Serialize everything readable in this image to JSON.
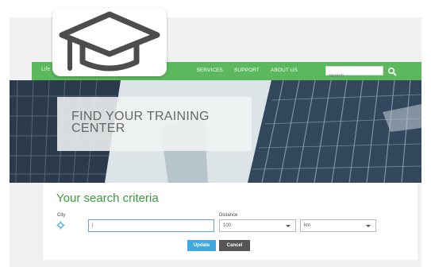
{
  "nav": {
    "brand": "Life",
    "links": [
      "S",
      "SERVICES",
      "SUPPORT",
      "ABOUT US"
    ],
    "search_placeholder": "Search"
  },
  "hero": {
    "title": "FIND YOUR TRAINING CENTER"
  },
  "criteria": {
    "heading": "Your search criteria",
    "city_label": "City",
    "city_value": "|",
    "distance_label": "Distance",
    "distance_value": "100",
    "unit_value": "km",
    "update_label": "Update",
    "cancel_label": "Cancel"
  },
  "colors": {
    "accent_green": "#5cb85c",
    "heading_green": "#3c9a43",
    "update_blue": "#3fa9e0",
    "cancel_gray": "#555555",
    "icon_gray": "#4d4d4d"
  },
  "icons": {
    "badge": "graduation-cap-icon",
    "locate": "crosshair-icon",
    "search": "search-icon"
  }
}
